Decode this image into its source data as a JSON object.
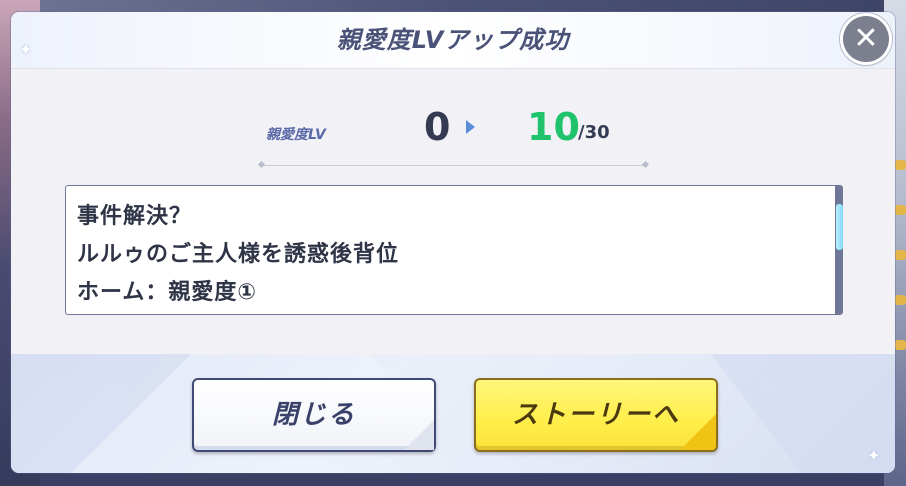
{
  "dialog": {
    "title": "親愛度LVアップ成功",
    "close_icon": "close-icon"
  },
  "level": {
    "label": "親愛度LV",
    "from": "0",
    "to": "10",
    "max": "/30",
    "to_color": "#1fc36c",
    "arrow_icon": "arrow-right-icon"
  },
  "rewards": {
    "lines": [
      "事件解決？",
      "ルルゥのご主人様を誘惑後背位",
      "ホーム：親愛度①"
    ]
  },
  "buttons": {
    "close_label": "閉じる",
    "story_label": "ストーリーへ"
  },
  "colors": {
    "title": "#4a5278",
    "story_button": "#ffee4a",
    "accent_green": "#1fc36c"
  }
}
